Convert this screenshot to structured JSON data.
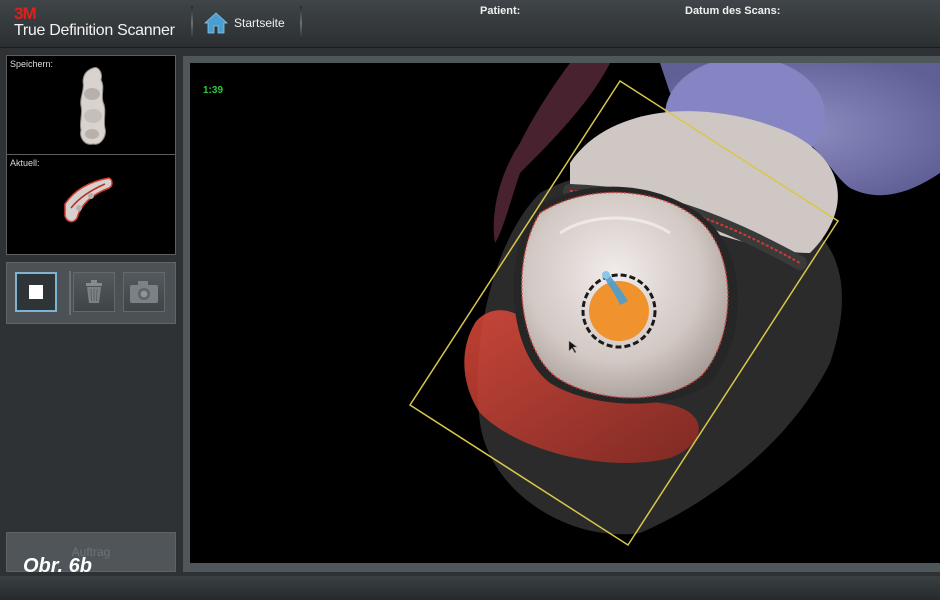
{
  "header": {
    "brand": "3M",
    "product": "True Definition Scanner",
    "home_label": "Startseite",
    "patient_label": "Patient:",
    "scan_date_label": "Datum des Scans:"
  },
  "left_panel": {
    "saved_label": "Speichern:",
    "current_label": "Aktuell:",
    "tools": [
      "stop-icon",
      "trash-icon",
      "camera-icon"
    ],
    "order_button": "Auftrag"
  },
  "viewport": {
    "timer": "1:39"
  },
  "figure_label": "Obr. 6b",
  "colors": {
    "accent_blue": "#4a9fd0",
    "timer_green": "#2fc83a",
    "brand_red": "#e0201c",
    "scan_frame_yellow": "#d9c64a",
    "focus_orange": "#f0932e"
  }
}
